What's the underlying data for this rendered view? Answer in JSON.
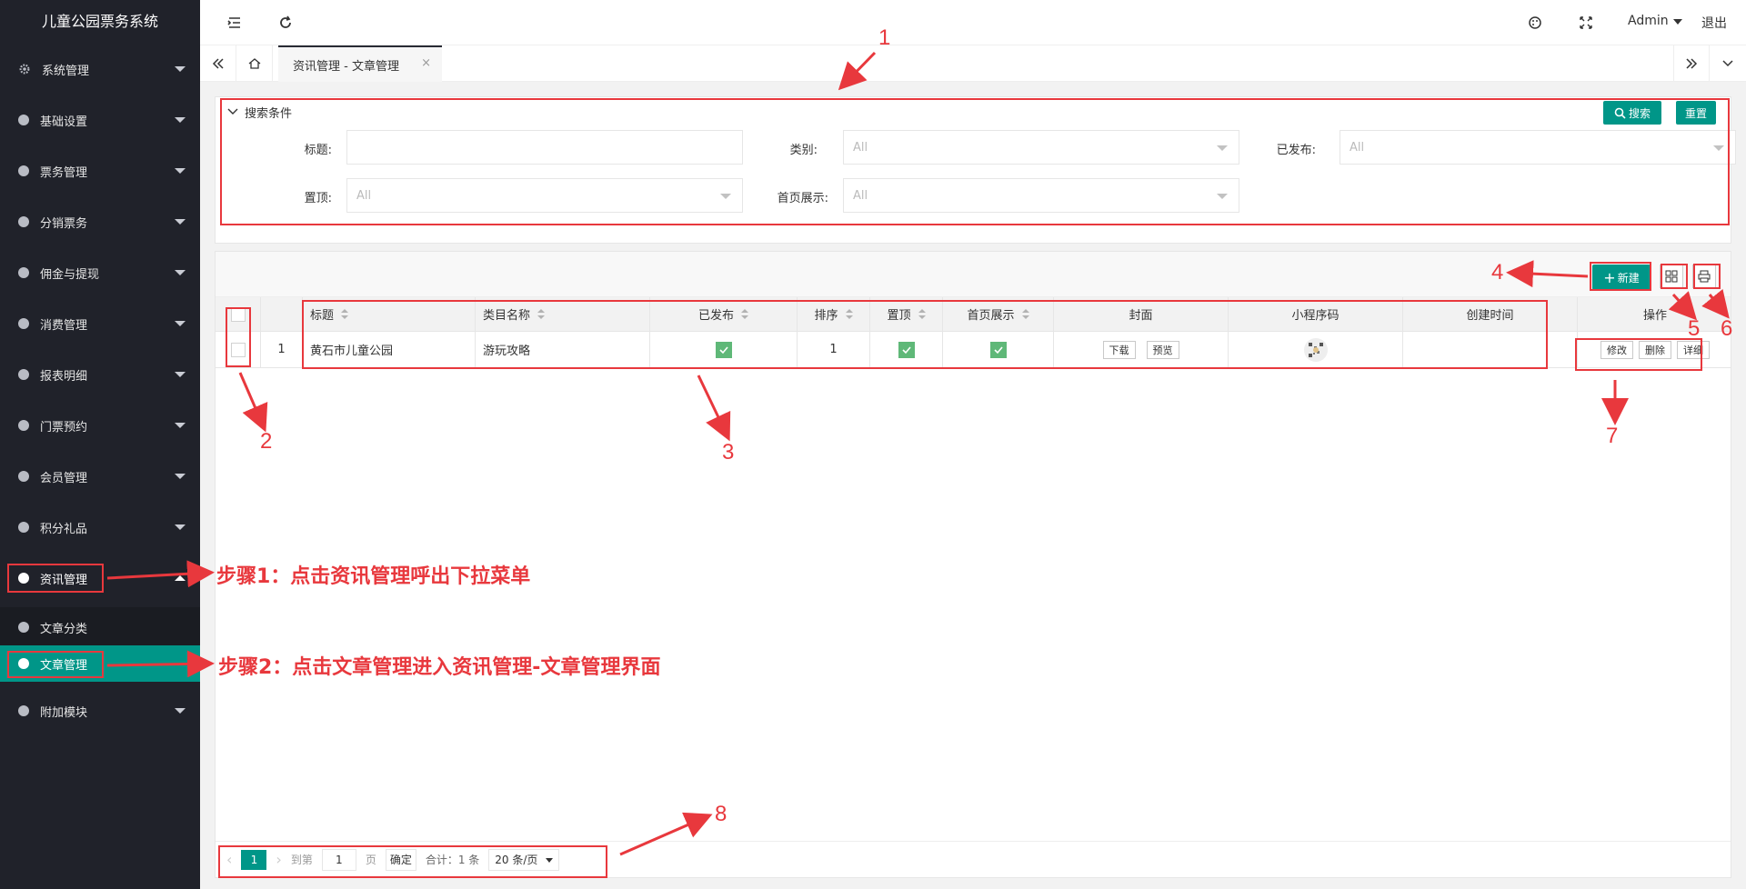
{
  "app": {
    "title": "儿童公园票务系统"
  },
  "sidebar": {
    "items": [
      {
        "label": "系统管理"
      },
      {
        "label": "基础设置"
      },
      {
        "label": "票务管理"
      },
      {
        "label": "分销票务"
      },
      {
        "label": "佣金与提现"
      },
      {
        "label": "消费管理"
      },
      {
        "label": "报表明细"
      },
      {
        "label": "门票预约"
      },
      {
        "label": "会员管理"
      },
      {
        "label": "积分礼品"
      },
      {
        "label": "资讯管理"
      },
      {
        "label": "附加模块"
      }
    ],
    "submenu": [
      {
        "label": "文章分类"
      },
      {
        "label": "文章管理"
      }
    ]
  },
  "topbar": {
    "user": "Admin",
    "logout": "退出"
  },
  "tabs": {
    "active": "资讯管理 - 文章管理",
    "close": "×"
  },
  "search": {
    "title": "搜索条件",
    "search_btn": "搜索",
    "reset_btn": "重置",
    "fields": {
      "title_label": "标题:",
      "category_label": "类别:",
      "published_label": "已发布:",
      "top_label": "置顶:",
      "home_label": "首页展示:",
      "select_placeholder": "All"
    }
  },
  "toolbar": {
    "new_btn": "新建"
  },
  "table": {
    "headers": [
      "标题",
      "类目名称",
      "已发布",
      "排序",
      "置顶",
      "首页展示",
      "封面",
      "小程序码",
      "创建时间",
      "操作"
    ],
    "rows": [
      {
        "index": "1",
        "title": "黄石市儿童公园",
        "category": "游玩攻略",
        "order": "1",
        "cover_download": "下载",
        "cover_preview": "预览",
        "op_edit": "修改",
        "op_delete": "删除",
        "op_detail": "详细"
      }
    ]
  },
  "pager": {
    "current": "1",
    "goto": "到第",
    "page_input": "1",
    "page_unit": "页",
    "confirm": "确定",
    "total": "合计：1 条",
    "page_size": "20 条/页"
  },
  "annotations": {
    "n1": "1",
    "n2": "2",
    "n3": "3",
    "n4": "4",
    "n5": "5",
    "n6": "6",
    "n7": "7",
    "n8": "8",
    "step1": "步骤1：点击资讯管理呼出下拉菜单",
    "step2": "步骤2：点击文章管理进入资讯管理-文章管理界面"
  },
  "colors": {
    "accent": "#009688",
    "sidebar": "#20222a",
    "annotation": "#e8383d",
    "check": "#5fb878"
  }
}
